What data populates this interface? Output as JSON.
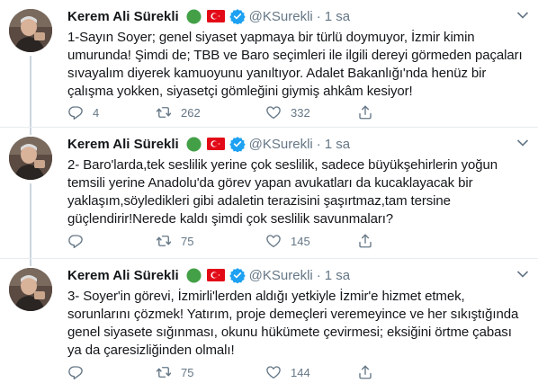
{
  "author": {
    "name": "Kerem Ali Sürekli",
    "handle": "@KSurekli",
    "time": "1 sa",
    "dot": "·"
  },
  "colors": {
    "flag_green": "#43a047",
    "flag_red": "#e30a17",
    "verified_blue": "#1da1f2",
    "divider": "#e6ecf0",
    "muted": "#657786"
  },
  "icons": [
    "green-circle-icon",
    "turkey-flag-icon",
    "verified-badge-icon",
    "chevron-down-icon",
    "reply-icon",
    "retweet-icon",
    "like-icon",
    "share-icon"
  ],
  "tweets": [
    {
      "text": "1-Sayın Soyer;  genel siyaset yapmaya bir türlü doymuyor, İzmir kimin umurunda! Şimdi de; TBB ve Baro seçimleri ile ilgili dereyi görmeden paçaları sıvayalım diyerek kamuoyunu yanıltıyor. Adalet Bakanlığı'nda henüz bir çalışma yokken, siyasetçi gömleğini giymiş ahkâm kesiyor!",
      "replies": "4",
      "retweets": "262",
      "likes": "332"
    },
    {
      "text": "2- Baro'larda,tek seslilik yerine çok seslilik, sadece büyükşehirlerin yoğun temsili yerine Anadolu'da görev yapan avukatları da kucaklayacak bir yaklaşım,söyledikleri gibi adaletin terazisini şaşırtmaz,tam tersine güçlendirir!Nerede kaldı şimdi çok seslilik savunmaları?",
      "replies": "",
      "retweets": "75",
      "likes": "145"
    },
    {
      "text": "3- Soyer'in  görevi, İzmirli'lerden aldığı yetkiyle İzmir'e hizmet etmek, sorunlarını çözmek! Yatırım, proje demeçleri veremeyince ve her sıkıştığında genel siyasete sığınması, okunu hükümete çevirmesi; eksiğini örtme çabası ya da çaresizliğinden olmalı!",
      "replies": "",
      "retweets": "75",
      "likes": "144"
    }
  ]
}
